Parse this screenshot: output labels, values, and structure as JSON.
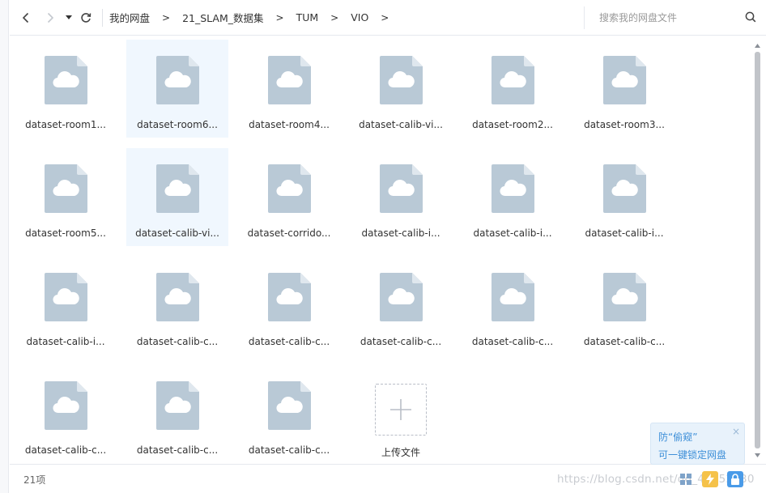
{
  "toolbar": {
    "breadcrumb": [
      "我的网盘",
      "21_SLAM_数据集",
      "TUM",
      "VIO"
    ],
    "separator": ">"
  },
  "search": {
    "placeholder": "搜索我的网盘文件"
  },
  "files": [
    {
      "name": "dataset-room1...",
      "selected": false
    },
    {
      "name": "dataset-room6...",
      "selected": true
    },
    {
      "name": "dataset-room4...",
      "selected": false
    },
    {
      "name": "dataset-calib-vi...",
      "selected": false
    },
    {
      "name": "dataset-room2...",
      "selected": false
    },
    {
      "name": "dataset-room3...",
      "selected": false
    },
    {
      "name": "dataset-room5...",
      "selected": false
    },
    {
      "name": "dataset-calib-vi...",
      "selected": true
    },
    {
      "name": "dataset-corrido...",
      "selected": false
    },
    {
      "name": "dataset-calib-i...",
      "selected": false
    },
    {
      "name": "dataset-calib-i...",
      "selected": false
    },
    {
      "name": "dataset-calib-i...",
      "selected": false
    },
    {
      "name": "dataset-calib-i...",
      "selected": false
    },
    {
      "name": "dataset-calib-c...",
      "selected": false
    },
    {
      "name": "dataset-calib-c...",
      "selected": false
    },
    {
      "name": "dataset-calib-c...",
      "selected": false
    },
    {
      "name": "dataset-calib-c...",
      "selected": false
    },
    {
      "name": "dataset-calib-c...",
      "selected": false
    },
    {
      "name": "dataset-calib-c...",
      "selected": false
    },
    {
      "name": "dataset-calib-c...",
      "selected": false
    },
    {
      "name": "dataset-calib-c...",
      "selected": false
    }
  ],
  "upload": {
    "label": "上传文件"
  },
  "status": {
    "count": "21项"
  },
  "watermark": "https://blog.csdn.net/qq_42952030",
  "popup": {
    "title": "防“偷窥”",
    "link": "可一键锁定网盘",
    "close": "×"
  },
  "colors": {
    "file_icon": "#b9c9d6",
    "file_fold": "#dfe7ee",
    "selected_bg": "#f0f7fe",
    "accent": "#3d8fd8"
  },
  "icons": {
    "back": "chevron-left-icon",
    "forward": "chevron-right-icon",
    "dropdown": "caret-down-icon",
    "refresh": "refresh-icon",
    "search": "search-icon",
    "file": "cloud-file-icon",
    "upload": "plus-icon"
  }
}
